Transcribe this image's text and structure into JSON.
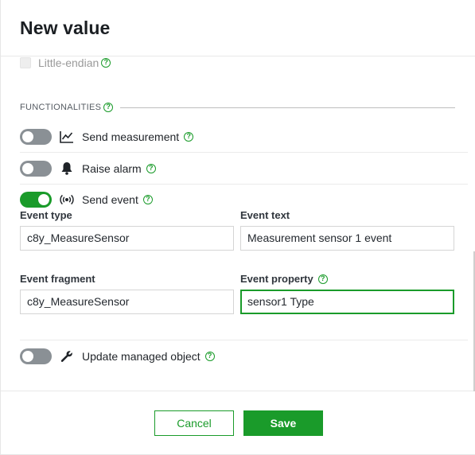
{
  "dialog": {
    "title": "New value"
  },
  "options": {
    "little_endian_label": "Little-endian",
    "little_endian_checked": false,
    "little_endian_disabled": true
  },
  "functionalities": {
    "section_label": "FUNCTIONALITIES",
    "send_measurement": {
      "label": "Send measurement",
      "enabled": false,
      "icon": "line-chart-icon"
    },
    "raise_alarm": {
      "label": "Raise alarm",
      "enabled": false,
      "icon": "bell-icon"
    },
    "send_event": {
      "label": "Send event",
      "enabled": true,
      "icon": "broadcast-icon"
    },
    "update_managed_object": {
      "label": "Update managed object",
      "enabled": false,
      "icon": "wrench-icon"
    }
  },
  "event": {
    "type_label": "Event type",
    "type_value": "c8y_MeasureSensor",
    "text_label": "Event text",
    "text_value": "Measurement sensor 1 event",
    "fragment_label": "Event fragment",
    "fragment_value": "c8y_MeasureSensor",
    "property_label": "Event property",
    "property_value": "sensor1 Type"
  },
  "footer": {
    "cancel_label": "Cancel",
    "save_label": "Save"
  },
  "colors": {
    "accent": "#1a9b2a",
    "toggle_off": "#8a9095"
  }
}
